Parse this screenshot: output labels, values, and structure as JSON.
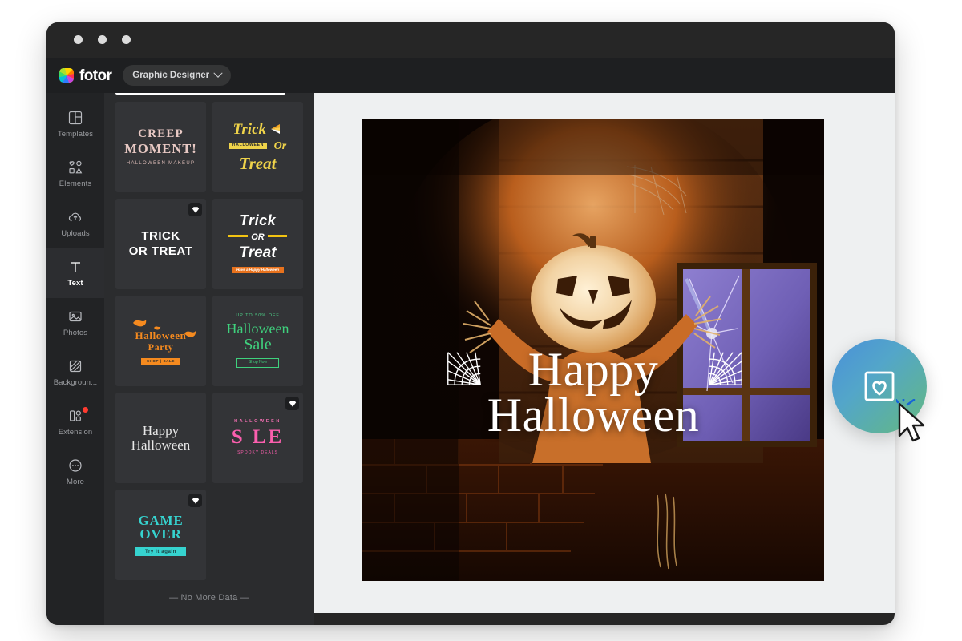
{
  "window": {
    "traffic_lights": [
      "close",
      "minimize",
      "maximize"
    ]
  },
  "header": {
    "logo_text": "fotor",
    "logo_icon": "fotor-rainbow-logo-icon",
    "role_label": "Graphic Designer",
    "role_chevron_icon": "chevron-down-icon"
  },
  "sidebar": {
    "items": [
      {
        "label": "Templates",
        "icon": "templates-grid-icon",
        "active": false,
        "badge": false
      },
      {
        "label": "Elements",
        "icon": "elements-shapes-icon",
        "active": false,
        "badge": false
      },
      {
        "label": "Uploads",
        "icon": "upload-cloud-icon",
        "active": false,
        "badge": false
      },
      {
        "label": "Text",
        "icon": "text-t-icon",
        "active": true,
        "badge": false
      },
      {
        "label": "Photos",
        "icon": "photo-image-icon",
        "active": false,
        "badge": false
      },
      {
        "label": "Backgroun...",
        "icon": "background-hatch-icon",
        "active": false,
        "badge": false
      },
      {
        "label": "Extension",
        "icon": "extension-puzzle-icon",
        "active": false,
        "badge": true
      },
      {
        "label": "More",
        "icon": "more-ellipsis-icon",
        "active": false,
        "badge": false
      }
    ]
  },
  "panel": {
    "footer_text": "— No More Data —",
    "premium_badge_icon": "diamond-icon",
    "templates": [
      {
        "id": "creep-moment",
        "name": "Creep Moment Halloween Makeup",
        "premium": false,
        "lines": {
          "l1": "Creep",
          "l2": "Moment!",
          "l3": "- HALLOWEEN MAKEUP -"
        }
      },
      {
        "id": "trick-or-treat-yellow",
        "name": "Trick or Treat candy corn",
        "premium": false,
        "lines": {
          "l1": "Trick",
          "tag": "HALLOWEEN",
          "or": "Or",
          "l2": "Treat"
        }
      },
      {
        "id": "trick-or-treat-drip",
        "name": "Trick or Treat drip witch",
        "premium": true,
        "lines": {
          "l1": "Trick",
          "l2": "Or Treat"
        }
      },
      {
        "id": "trick-or-treat-bold",
        "name": "Trick or Treat bold italic",
        "premium": false,
        "lines": {
          "l1": "Trick",
          "or": "OR",
          "l2": "Treat",
          "foot": "Have a Happy Halloween"
        }
      },
      {
        "id": "halloween-party",
        "name": "Halloween Party bats",
        "premium": false,
        "lines": {
          "l1": "Halloween",
          "l2": "Party",
          "tag": "SHOP | SALE"
        }
      },
      {
        "id": "halloween-sale-green",
        "name": "Halloween Sale green",
        "premium": false,
        "lines": {
          "l0": "UP TO 50% OFF",
          "l1": "Halloween",
          "l2": "Sale",
          "btn": "Shop Now"
        }
      },
      {
        "id": "happy-halloween-web",
        "name": "Happy Halloween spiderweb",
        "premium": false,
        "lines": {
          "l1": "Happy",
          "l2": "Halloween"
        }
      },
      {
        "id": "halloween-sale-pink",
        "name": "Halloween Sale pink witch",
        "premium": true,
        "lines": {
          "l0": "HALLOWEEN",
          "l1": "S LE",
          "l2": "SPOOKY DEALS"
        }
      },
      {
        "id": "game-over",
        "name": "Game Over try it again",
        "premium": true,
        "lines": {
          "l1": "GAME OVER",
          "btn": "Try it again"
        }
      }
    ]
  },
  "canvas": {
    "artboard_name": "halloween-scarecrow-artboard",
    "heading_line1": "Happy",
    "heading_line2": "Halloween",
    "decoration_icon": "spiderweb-corner-icon"
  },
  "fab": {
    "name": "favorite-template-button",
    "icon": "heart-in-frame-icon",
    "cursor_icon": "mouse-pointer-cursor-icon",
    "gradient_from": "#4a90d9",
    "gradient_to": "#64b97f"
  },
  "colors": {
    "window_chrome": "#262626",
    "header_bg": "#1e1f21",
    "rail_bg": "#222325",
    "panel_bg": "#2b2c2e",
    "card_bg": "#333437",
    "workspace_bg": "#eef0f1",
    "active_text": "#ffffff",
    "muted_text": "#9a9ca0",
    "notification_dot": "#ff3b30"
  }
}
